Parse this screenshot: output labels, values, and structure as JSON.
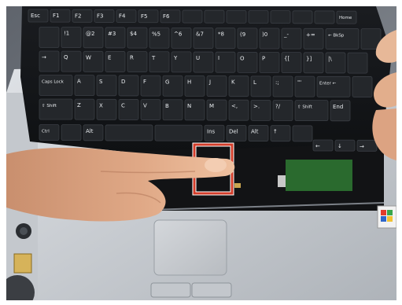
{
  "image": {
    "subject": "laptop-keyboard-removal",
    "highlight_color": "#d33d2a"
  },
  "keyboard": {
    "rows": [
      {
        "keys": [
          "Esc",
          "F1",
          "F2",
          "F3",
          "F4",
          "F5",
          "F6",
          "",
          "",
          "",
          "",
          "",
          "",
          "",
          "Home"
        ]
      },
      {
        "keys": [
          "",
          "!1",
          "@2",
          "#3",
          "$4",
          "%5",
          "^6",
          "&7",
          "*8",
          "(9",
          ")0",
          "_-",
          "+=",
          "← BkSp",
          ""
        ]
      },
      {
        "keys": [
          "→",
          "Q",
          "W",
          "E",
          "R",
          "T",
          "Y",
          "U",
          "I",
          "O",
          "P",
          "{[",
          "}]",
          "|\\",
          ""
        ]
      },
      {
        "keys": [
          "Caps Lock",
          "A",
          "S",
          "D",
          "F",
          "G",
          "H",
          "J",
          "K",
          "L",
          ":;",
          "\"'",
          "Enter ←",
          ""
        ]
      },
      {
        "keys": [
          "⇧ Shift",
          "Z",
          "X",
          "C",
          "V",
          "B",
          "N",
          "M",
          "<,",
          ">.",
          "?/",
          "⇧ Shift",
          "End"
        ]
      },
      {
        "keys": [
          "Ctrl",
          "",
          "Alt",
          "",
          "",
          "Ins",
          "Del",
          "Alt",
          "↑",
          ""
        ]
      },
      {
        "keys": [
          "←",
          "↓",
          "→"
        ]
      }
    ]
  }
}
